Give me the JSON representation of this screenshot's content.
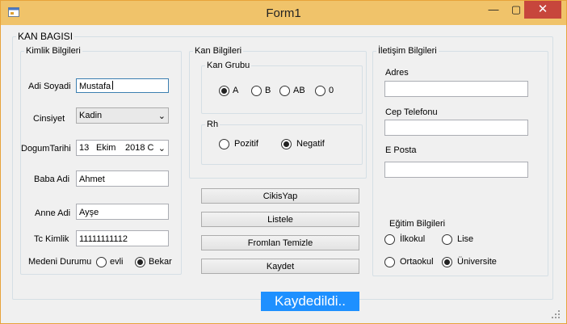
{
  "window": {
    "title": "Form1",
    "minimize": "—",
    "maximize": "▢",
    "close": "✕"
  },
  "main_group": {
    "legend": "KAN BAGISI"
  },
  "kimlik": {
    "legend": "Kimlik Bilgileri",
    "ad_soyad_label": "Adi Soyadi",
    "ad_soyad_value": "Mustafa",
    "cinsiyet_label": "Cinsiyet",
    "cinsiyet_value": "Kadin",
    "dogum_label": "DogumTarihi",
    "dogum_day": "13",
    "dogum_month": "Ekim",
    "dogum_year": "2018 C",
    "baba_label": "Baba Adi",
    "baba_value": "Ahmet",
    "anne_label": "Anne Adi",
    "anne_value": "Ayşe",
    "tc_label": "Tc Kimlik",
    "tc_value": "11111111112",
    "medeni_label": "Medeni Durumu",
    "medeni_opt1": "evli",
    "medeni_opt2": "Bekar",
    "medeni_selected": "Bekar"
  },
  "kan": {
    "legend": "Kan Bilgileri",
    "grup_legend": "Kan Grubu",
    "grup_options": [
      "A",
      "B",
      "AB",
      "0"
    ],
    "grup_selected": "A",
    "rh_legend": "Rh",
    "rh_options": [
      "Pozitif",
      "Negatif"
    ],
    "rh_selected": "Negatif"
  },
  "buttons": {
    "cikis": "CikisYap",
    "listele": "Listele",
    "temizle": "Fromlan Temizle",
    "kaydet": "Kaydet"
  },
  "iletisim": {
    "legend": "İletişim Bilgileri",
    "adres_label": "Adres",
    "adres_value": "",
    "cep_label": "Cep Telefonu",
    "cep_value": "",
    "eposta_label": "E Posta",
    "eposta_value": "",
    "egitim_label": "Eğitim Bilgileri",
    "egitim_options": [
      "İlkokul",
      "Lise",
      "Ortaokul",
      "Üniversite"
    ],
    "egitim_selected": "Üniversite"
  },
  "status": {
    "message": "Kaydedildi.."
  },
  "colors": {
    "titlebar": "#f0c36a",
    "close_button": "#c7463c",
    "status_bg": "#1e90ff"
  }
}
